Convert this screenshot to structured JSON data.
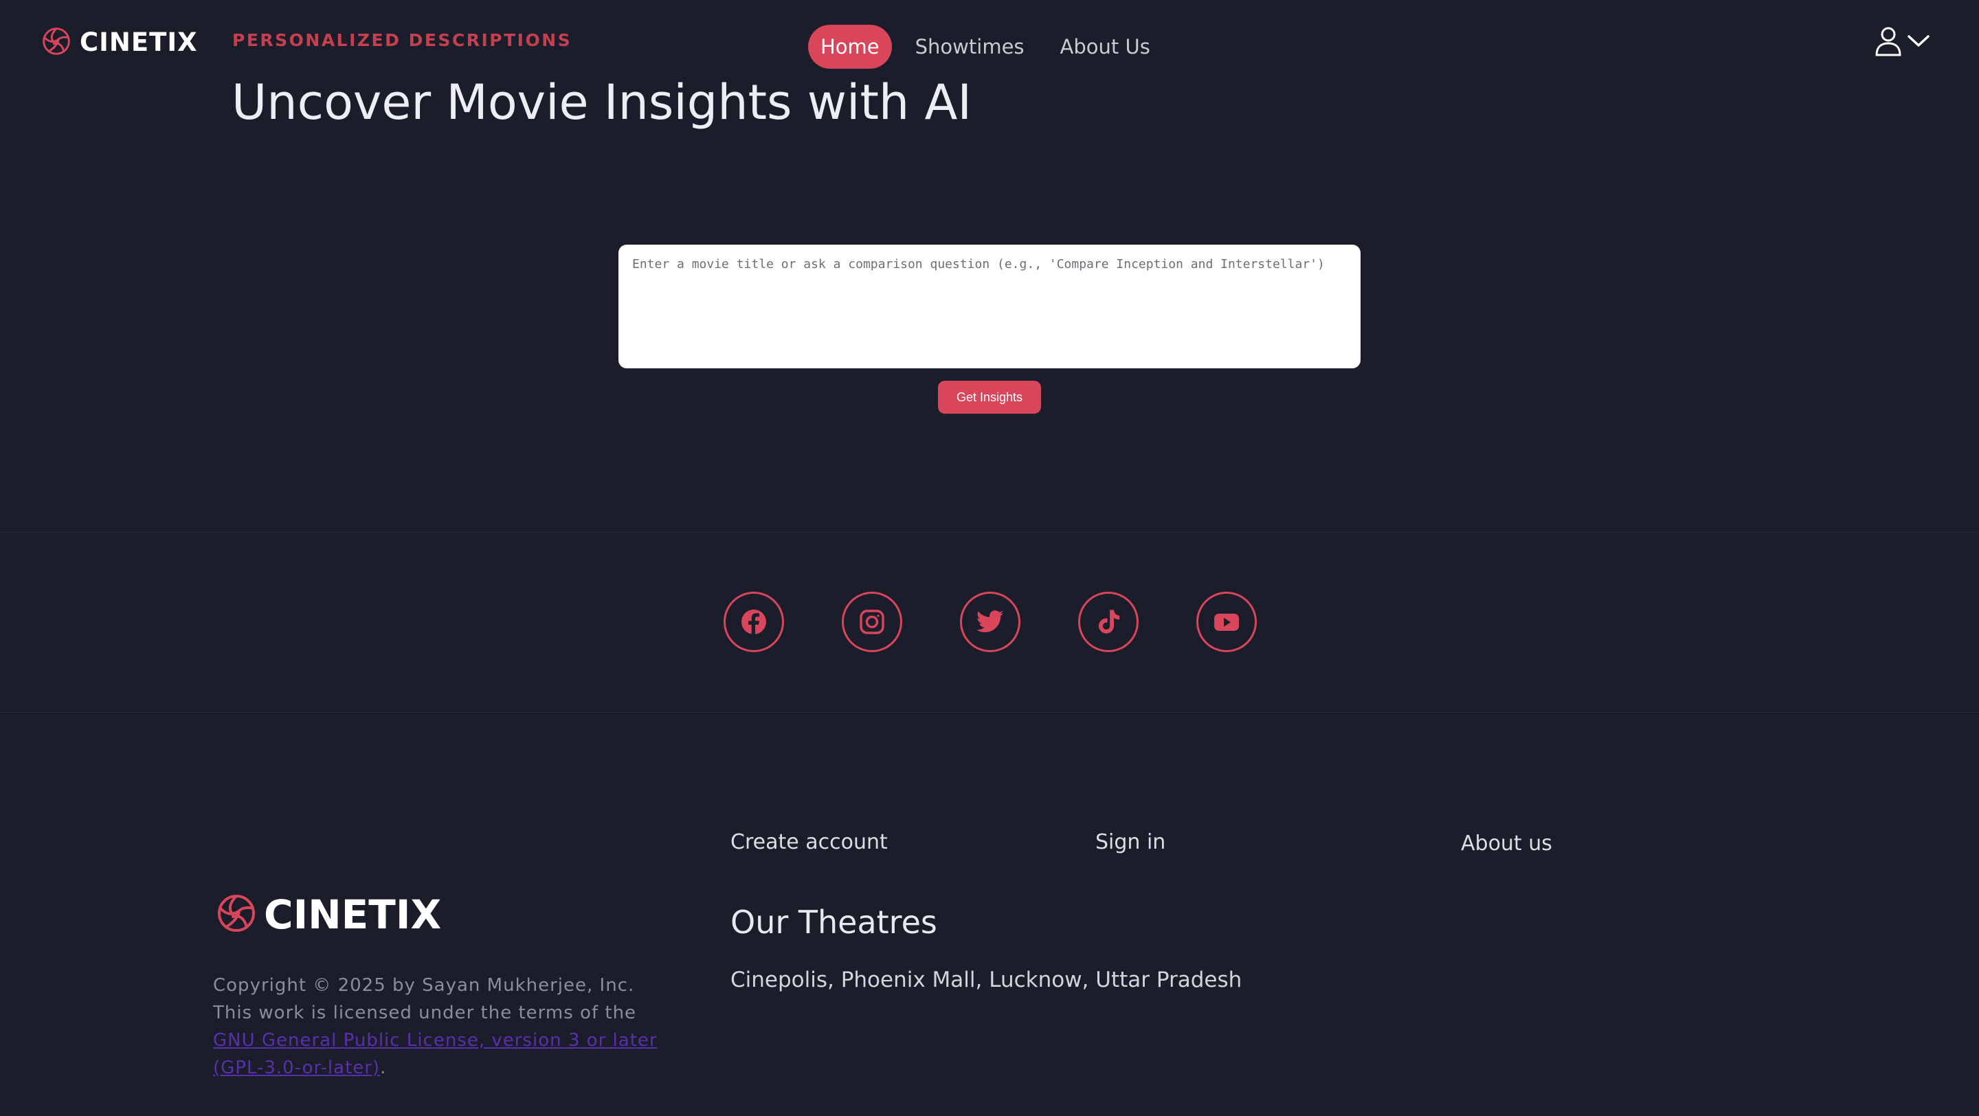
{
  "brand": {
    "name": "CINETIX",
    "accent_color": "#d9455a",
    "logo_icon": "aperture-icon"
  },
  "nav": {
    "items": [
      {
        "label": "Home",
        "active": true
      },
      {
        "label": "Showtimes",
        "active": false
      },
      {
        "label": "About Us",
        "active": false
      }
    ]
  },
  "user_menu": {
    "icon": "user-icon",
    "caret_icon": "chevron-down-icon"
  },
  "hero": {
    "eyebrow": "PERSONALIZED DESCRIPTIONS",
    "title": "Uncover Movie Insights with AI",
    "input_placeholder": "Enter a movie title or ask a comparison question (e.g., 'Compare Inception and Interstellar')",
    "input_value": "",
    "button_label": "Get Insights"
  },
  "social": {
    "icons": [
      "facebook-icon",
      "instagram-icon",
      "twitter-icon",
      "tiktok-icon",
      "youtube-icon"
    ]
  },
  "footer": {
    "brand": "CINETIX",
    "copyright_prefix": "Copyright © 2025 by Sayan Mukherjee, Inc. This work is licensed under the terms of the ",
    "license_link": "GNU General Public License, version 3 or later (GPL-3.0-or-later)",
    "copyright_suffix": ".",
    "links": {
      "create_account": "Create account",
      "sign_in": "Sign in",
      "about_us": "About us"
    },
    "theatres_heading": "Our Theatres",
    "theatre_address": "Cinepolis, Phoenix Mall, Lucknow, Uttar Pradesh"
  }
}
